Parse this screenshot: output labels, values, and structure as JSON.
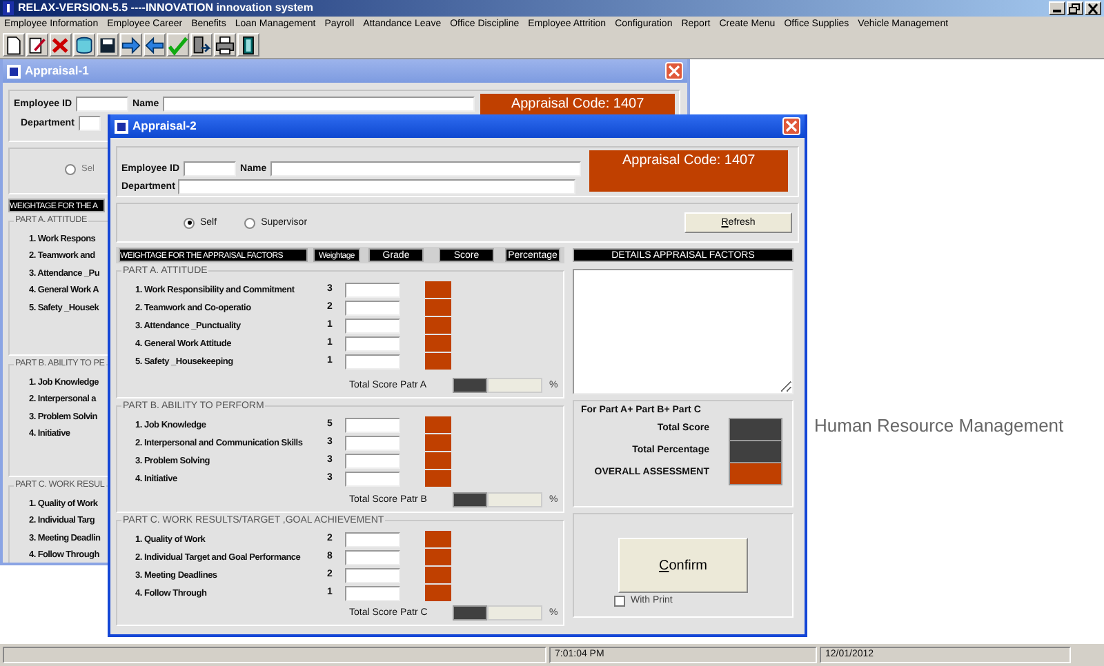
{
  "app": {
    "title": "RELAX-VERSION-5.5 ----INNOVATION innovation system"
  },
  "menu": [
    "Employee Information",
    "Employee Career",
    "Benefits",
    "Loan Management",
    "Payroll",
    "Attandance  Leave",
    "Office Discipline",
    "Employee Attrition",
    "Configuration",
    "Report",
    "Create Menu",
    "Office Supplies",
    "Vehicle Management"
  ],
  "back_window": {
    "title": "Appraisal-1",
    "employee_id_label": "Employee ID",
    "name_label": "Name",
    "department_label": "Department",
    "code": "Appraisal Code: 1407",
    "radio_label": "Sel",
    "radio_selected": false,
    "header": "WEIGHTAGE FOR THE A",
    "parts": [
      {
        "title": "PART A. ATTITUDE",
        "items": [
          "1.  Work Respons",
          "2.  Teamwork and",
          "3. Attendance _Pu",
          "4. General Work A",
          "5. Safety _Housek"
        ]
      },
      {
        "title": "PART B. ABILITY TO PE",
        "items": [
          "1.  Job Knowledge",
          "2.  Interpersonal a",
          "3.  Problem Solvin",
          "4.  Initiative"
        ]
      },
      {
        "title": "PART C. WORK RESUL",
        "items": [
          "1.  Quality of Work",
          "2.  Individual Targ",
          "3.  Meeting Deadlin",
          "4.  Follow Through"
        ]
      }
    ]
  },
  "front_window": {
    "title": "Appraisal-2",
    "employee_id_label": "Employee ID",
    "name_label": "Name",
    "department_label": "Department",
    "code": "Appraisal Code: 1407",
    "radios": [
      {
        "label": "Self",
        "selected": true
      },
      {
        "label": "Supervisor",
        "selected": false
      }
    ],
    "refresh_button": "Refresh",
    "columns": [
      "WEIGHTAGE FOR THE APPRAISAL FACTORS",
      "Weightage",
      "Grade",
      "Score",
      "Percentage"
    ],
    "details_header": "DETAILS APPRAISAL FACTORS",
    "parts": [
      {
        "title": "PART A.  ATTITUDE",
        "total_label": "Total Score Patr A",
        "items": [
          {
            "label": "1.  Work Responsibility and Commitment",
            "weight": "3"
          },
          {
            "label": "2.  Teamwork and Co-operatio",
            "weight": "2"
          },
          {
            "label": "3. Attendance _Punctuality",
            "weight": "1"
          },
          {
            "label": "4. General Work Attitude",
            "weight": "1"
          },
          {
            "label": "5. Safety _Housekeeping",
            "weight": "1"
          }
        ]
      },
      {
        "title": "PART B.  ABILITY TO PERFORM",
        "total_label": "Total Score Patr B",
        "items": [
          {
            "label": "1.  Job Knowledge",
            "weight": "5"
          },
          {
            "label": "2.  Interpersonal and Communication Skills",
            "weight": "3"
          },
          {
            "label": "3.  Problem Solving",
            "weight": "3"
          },
          {
            "label": "4.  Initiative",
            "weight": "3"
          }
        ]
      },
      {
        "title": "PART C.  WORK RESULTS/TARGET ,GOAL ACHIEVEMENT",
        "total_label": "Total Score Patr C",
        "items": [
          {
            "label": "1.  Quality of Work",
            "weight": "2"
          },
          {
            "label": "2.  Individual Target and Goal Performance",
            "weight": "8"
          },
          {
            "label": "3.  Meeting Deadlines",
            "weight": "2"
          },
          {
            "label": "4.  Follow Through",
            "weight": "1"
          }
        ]
      }
    ],
    "percent_sign": "%",
    "summary": {
      "title": "For Part A+ Part B+ Part C",
      "rows": [
        {
          "label": "Total Score",
          "color": "#404040"
        },
        {
          "label": "Total Percentage",
          "color": "#404040"
        },
        {
          "label": "OVERALL ASSESSMENT",
          "color": "#c04000"
        }
      ]
    },
    "confirm_button": "Confirm",
    "with_print": {
      "label": "With Print",
      "checked": false
    }
  },
  "desktop_caption": "Human Resource Management",
  "status_bar": {
    "time": "7:01:04 PM",
    "date": "12/01/2012"
  }
}
